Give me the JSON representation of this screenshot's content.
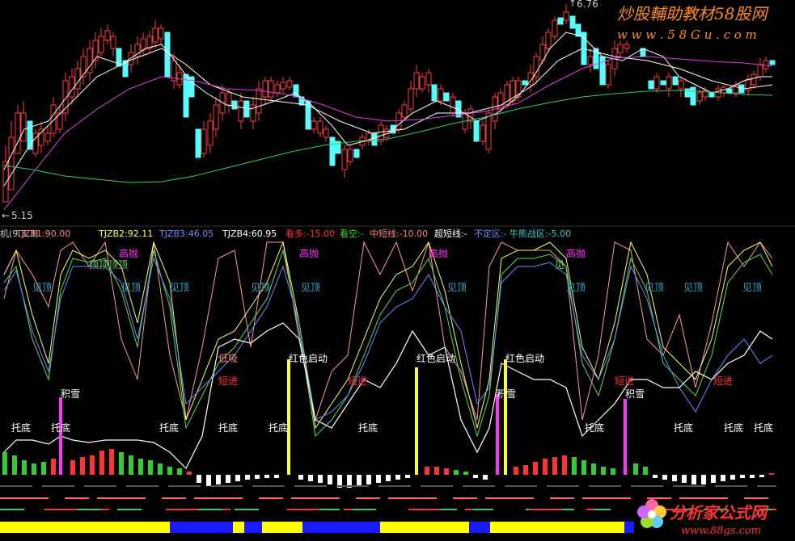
{
  "top_pane": {
    "high_price_label": "6.76",
    "low_price_label": "5.15",
    "watermark_title": "炒股輔助教材58股网",
    "watermark_url": "w w w . 5 8 G u . c o m"
  },
  "indicator_header": [
    {
      "text": "机(9,3,3)",
      "color": "#cccccc"
    },
    {
      "text": "TJZB1:90.00",
      "color": "#ff8080"
    },
    {
      "text": "TJZB2:92.11",
      "color": "#ffff66"
    },
    {
      "text": "TJZB3:46.05",
      "color": "#6a8cff"
    },
    {
      "text": "TJZB4:60.95",
      "color": "#ffffff"
    },
    {
      "text": "看多:-15.00",
      "color": "#ff3333"
    },
    {
      "text": "看空:-",
      "color": "#33dd33"
    },
    {
      "text": "中短线:-10.00",
      "color": "#ff8080"
    },
    {
      "text": "超短线:-",
      "color": "#ffffff"
    },
    {
      "text": "不定区:-",
      "color": "#6a8cff"
    },
    {
      "text": "牛熊战区:-5.00",
      "color": "#33cccc"
    }
  ],
  "signals": {
    "gao_pao": "高抛",
    "ding_ding_ding": "顶顶顶顶",
    "jian_ding": "见顶",
    "di_xi": "低吸",
    "duan_jin": "短进",
    "hong_se_qi_dong": "红色启动",
    "ji_xue": "积雪",
    "tuo_di": "托底",
    "jian": "见"
  },
  "bottom_watermark": {
    "title": "分析家公式网",
    "url": "www.88gs.com"
  },
  "colors": {
    "up_candle": "#ff3c3c",
    "down_candle": "#54ffff",
    "ma_white": "#ffffff",
    "ma_magenta": "#dd44dd",
    "ma_green": "#33cc66",
    "signal_yellow": "#ffff22",
    "signal_magenta": "#ff33ff"
  }
}
